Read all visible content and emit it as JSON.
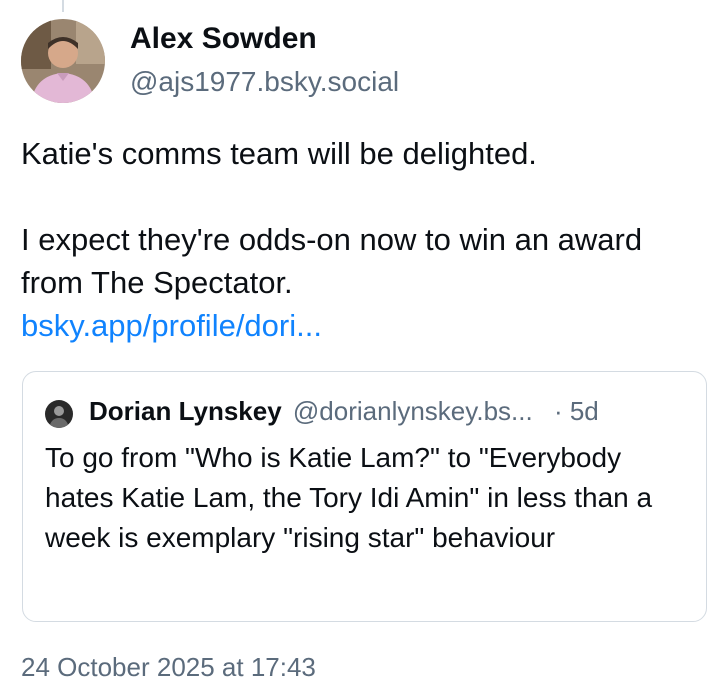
{
  "post": {
    "author": {
      "display_name": "Alex Sowden",
      "handle": "@ajs1977.bsky.social"
    },
    "text_line1": "Katie's comms team will be delighted.",
    "text_line2": "I expect they're odds-on now to win an award from The Spectator.",
    "link_text": "bsky.app/profile/dori...",
    "timestamp": "24 October 2025 at 17:43"
  },
  "quote": {
    "display_name": "Dorian Lynskey",
    "handle": "@dorianlynskey.bs...",
    "time": "· 5d",
    "text": "To go from \"Who is Katie Lam?\" to \"Everybody hates Katie Lam, the Tory Idi Amin\" in less than a week is exemplary \"rising star\" behaviour"
  },
  "colors": {
    "link": "#1083fe",
    "secondary_text": "#5b6b7c",
    "border": "#d4dbe2"
  }
}
